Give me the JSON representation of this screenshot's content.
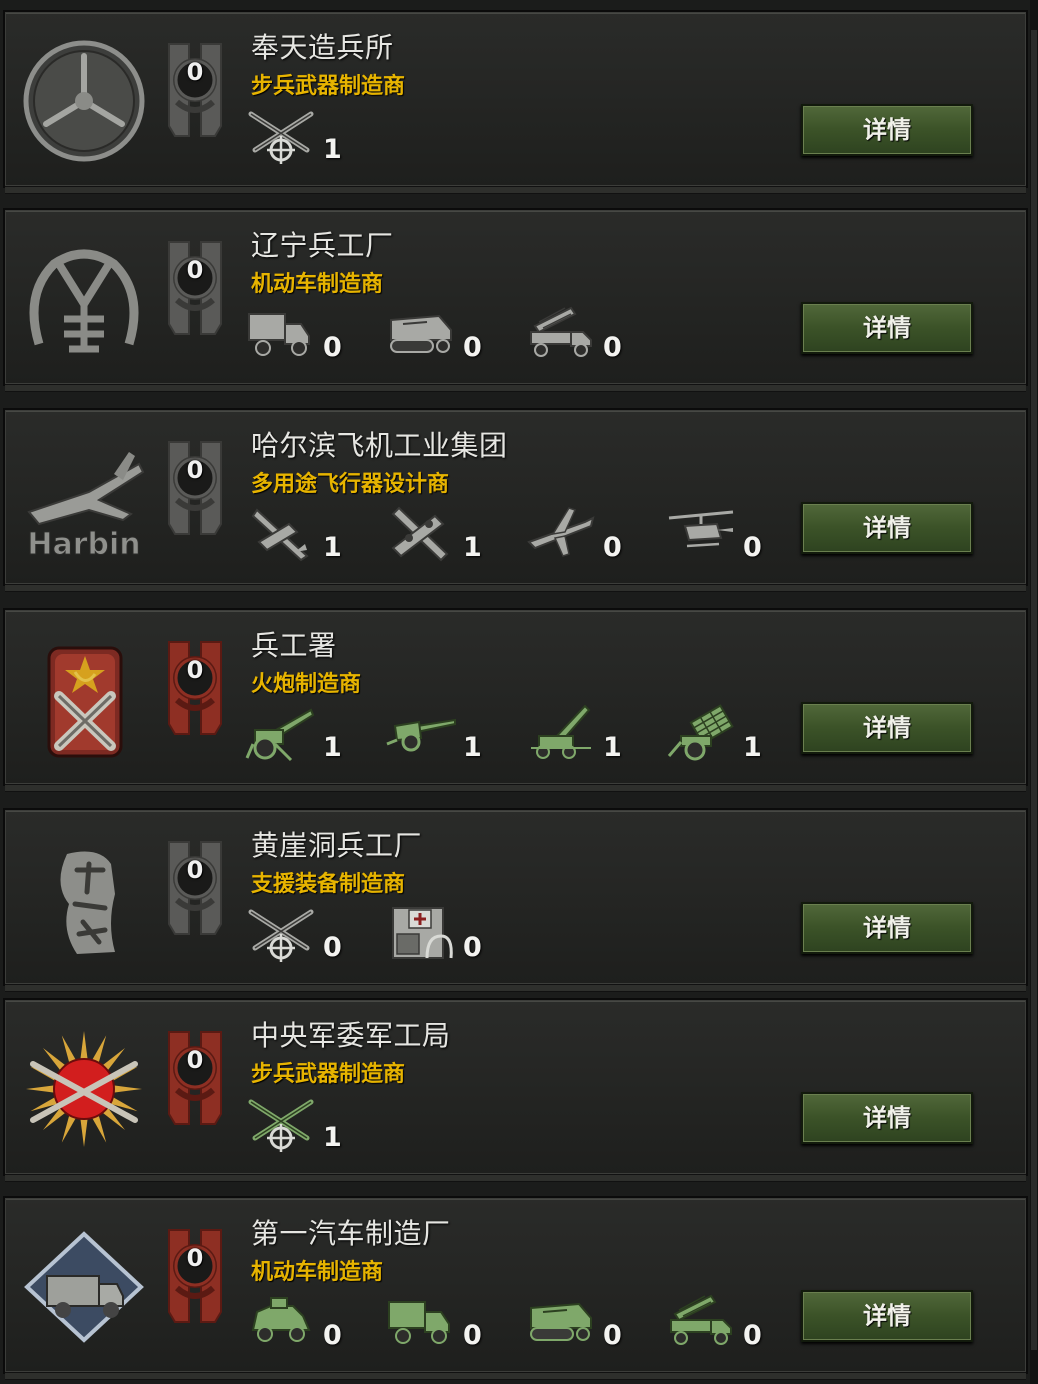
{
  "detail_button_label": "详情",
  "colors": {
    "name": "#e6e6e2",
    "type": "#e7b400",
    "button": "#3c5328",
    "rank_gray": "#5a5a58",
    "rank_red": "#8e2f23"
  },
  "manufacturers": [
    {
      "name": "奉天造兵所",
      "type": "步兵武器制造商",
      "rank": "0",
      "rank_style": "gray",
      "logo": "fengtian-wheel-logo",
      "tint": "gray",
      "equipment": [
        {
          "icon": "crossed-rifles-icon",
          "count": "1"
        }
      ]
    },
    {
      "name": "辽宁兵工厂",
      "type": "机动车制造商",
      "rank": "0",
      "rank_style": "gray",
      "logo": "liaoning-arsenal-logo",
      "tint": "gray",
      "equipment": [
        {
          "icon": "truck-icon",
          "count": "0"
        },
        {
          "icon": "halftrack-icon",
          "count": "0"
        },
        {
          "icon": "rocket-truck-icon",
          "count": "0"
        }
      ]
    },
    {
      "name": "哈尔滨飞机工业集团",
      "type": "多用途飞行器设计商",
      "rank": "0",
      "rank_style": "gray",
      "logo": "harbin-plane-logo",
      "logo_text": "Harbin",
      "tint": "gray",
      "equipment": [
        {
          "icon": "fighter-plane-icon",
          "count": "1"
        },
        {
          "icon": "heavy-fighter-icon",
          "count": "1"
        },
        {
          "icon": "transport-plane-icon",
          "count": "0"
        },
        {
          "icon": "helicopter-icon",
          "count": "0"
        }
      ]
    },
    {
      "name": "兵工署",
      "type": "火炮制造商",
      "rank": "0",
      "rank_style": "red",
      "logo": "soviet-artillery-logo",
      "tint": "green",
      "equipment": [
        {
          "icon": "artillery-icon",
          "count": "1"
        },
        {
          "icon": "anti-tank-gun-icon",
          "count": "1"
        },
        {
          "icon": "anti-air-gun-icon",
          "count": "1"
        },
        {
          "icon": "rocket-artillery-icon",
          "count": "1"
        }
      ]
    },
    {
      "name": "黄崖洞兵工厂",
      "type": "支援装备制造商",
      "rank": "0",
      "rank_style": "gray",
      "logo": "huangyadong-calligraphy-logo",
      "tint": "gray",
      "equipment": [
        {
          "icon": "crossed-rifles-icon",
          "count": "0"
        },
        {
          "icon": "support-equipment-icon",
          "count": "0"
        }
      ]
    },
    {
      "name": "中央军委军工局",
      "type": "步兵武器制造商",
      "rank": "0",
      "rank_style": "red",
      "logo": "sun-rifles-logo",
      "tint": "green",
      "equipment": [
        {
          "icon": "crossed-rifles-icon",
          "count": "1"
        }
      ]
    },
    {
      "name": "第一汽车制造厂",
      "type": "机动车制造商",
      "rank": "0",
      "rank_style": "red",
      "logo": "faw-truck-logo",
      "tint": "green",
      "equipment": [
        {
          "icon": "armored-car-icon",
          "count": "0"
        },
        {
          "icon": "truck-icon",
          "count": "0"
        },
        {
          "icon": "halftrack-icon",
          "count": "0"
        },
        {
          "icon": "rocket-truck-icon",
          "count": "0"
        }
      ]
    }
  ]
}
